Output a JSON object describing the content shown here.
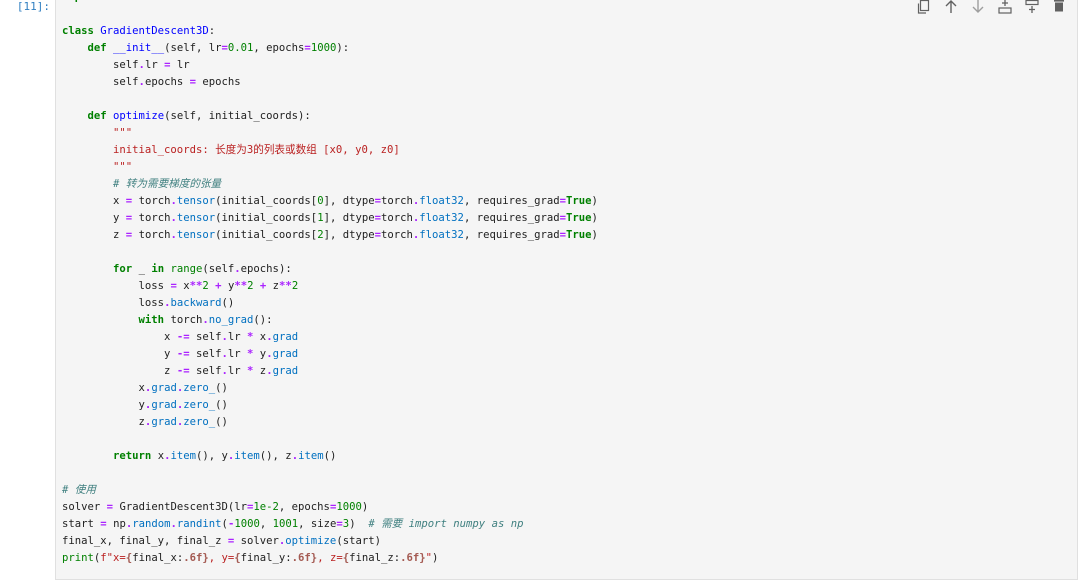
{
  "prompt": "[11]:",
  "toolbar": [
    {
      "name": "duplicate-icon"
    },
    {
      "name": "move-up-icon"
    },
    {
      "name": "move-down-icon"
    },
    {
      "name": "insert-above-icon"
    },
    {
      "name": "insert-below-icon"
    },
    {
      "name": "delete-icon"
    }
  ],
  "code_lines": [
    [
      [
        "kw",
        "import"
      ],
      [
        "",
        "torch"
      ]
    ],
    [],
    [
      [
        "kw",
        "class"
      ],
      [
        "def",
        "GradientDescent3D"
      ],
      [
        "",
        ":"
      ]
    ],
    [
      [
        "",
        "    "
      ],
      [
        "kw",
        "def"
      ],
      [
        "def",
        "__init__"
      ],
      [
        "",
        "(self, lr"
      ],
      [
        "op",
        "="
      ],
      [
        "num",
        "0.01"
      ],
      [
        "",
        ", epochs"
      ],
      [
        "op",
        "="
      ],
      [
        "num",
        "1000"
      ],
      [
        "",
        "):"
      ]
    ],
    [
      [
        "",
        "        self"
      ],
      [
        "op",
        "."
      ],
      [
        "",
        "lr "
      ],
      [
        "op",
        "="
      ],
      [
        "",
        ""
      ],
      [
        "",
        "lr"
      ]
    ],
    [
      [
        "",
        "        self"
      ],
      [
        "op",
        "."
      ],
      [
        "",
        "epochs "
      ],
      [
        "op",
        "="
      ],
      [
        "",
        "epochs"
      ]
    ],
    [],
    [
      [
        "",
        "    "
      ],
      [
        "kw",
        "def"
      ],
      [
        "def",
        "optimize"
      ],
      [
        "",
        "(self, initial_coords):"
      ]
    ],
    [
      [
        "",
        "        "
      ],
      [
        "str",
        "\"\"\""
      ]
    ],
    [
      [
        "",
        "        "
      ],
      [
        "str",
        "initial_coords: 长度为3的列表或数组 [x0, y0, z0]"
      ]
    ],
    [
      [
        "",
        "        "
      ],
      [
        "str",
        "\"\"\""
      ]
    ],
    [
      [
        "",
        "        "
      ],
      [
        "com",
        "# 转为需要梯度的张量"
      ]
    ],
    [
      [
        "",
        "        x "
      ],
      [
        "op",
        "="
      ],
      [
        "",
        "torch"
      ],
      [
        "op",
        "."
      ],
      [
        "attr",
        "tensor"
      ],
      [
        "",
        "(initial_coords["
      ],
      [
        "num",
        "0"
      ],
      [
        "",
        "], dtype"
      ],
      [
        "op",
        "="
      ],
      [
        "",
        "torch"
      ],
      [
        "op",
        "."
      ],
      [
        "attr",
        "float32"
      ],
      [
        "",
        ", requires_grad"
      ],
      [
        "op",
        "="
      ],
      [
        "kw",
        "True"
      ],
      [
        "",
        ")"
      ]
    ],
    [
      [
        "",
        "        y "
      ],
      [
        "op",
        "="
      ],
      [
        "",
        "torch"
      ],
      [
        "op",
        "."
      ],
      [
        "attr",
        "tensor"
      ],
      [
        "",
        "(initial_coords["
      ],
      [
        "num",
        "1"
      ],
      [
        "",
        "], dtype"
      ],
      [
        "op",
        "="
      ],
      [
        "",
        "torch"
      ],
      [
        "op",
        "."
      ],
      [
        "attr",
        "float32"
      ],
      [
        "",
        ", requires_grad"
      ],
      [
        "op",
        "="
      ],
      [
        "kw",
        "True"
      ],
      [
        "",
        ")"
      ]
    ],
    [
      [
        "",
        "        z "
      ],
      [
        "op",
        "="
      ],
      [
        "",
        "torch"
      ],
      [
        "op",
        "."
      ],
      [
        "attr",
        "tensor"
      ],
      [
        "",
        "(initial_coords["
      ],
      [
        "num",
        "2"
      ],
      [
        "",
        "], dtype"
      ],
      [
        "op",
        "="
      ],
      [
        "",
        "torch"
      ],
      [
        "op",
        "."
      ],
      [
        "attr",
        "float32"
      ],
      [
        "",
        ", requires_grad"
      ],
      [
        "op",
        "="
      ],
      [
        "kw",
        "True"
      ],
      [
        "",
        ")"
      ]
    ],
    [],
    [
      [
        "",
        "        "
      ],
      [
        "kw",
        "for"
      ],
      [
        "",
        ""
      ],
      [
        "",
        "_"
      ],
      [
        "",
        ""
      ],
      [
        "kw",
        "in"
      ],
      [
        "bi",
        "range"
      ],
      [
        "",
        "(self"
      ],
      [
        "op",
        "."
      ],
      [
        "",
        "epochs):"
      ]
    ],
    [
      [
        "",
        "            loss "
      ],
      [
        "op",
        "="
      ],
      [
        "",
        "x"
      ],
      [
        "op",
        "**"
      ],
      [
        "num",
        "2"
      ],
      [
        "op",
        "+"
      ],
      [
        "",
        "y"
      ],
      [
        "op",
        "**"
      ],
      [
        "num",
        "2"
      ],
      [
        "op",
        "+"
      ],
      [
        "",
        "z"
      ],
      [
        "op",
        "**"
      ],
      [
        "num",
        "2"
      ]
    ],
    [
      [
        "",
        "            loss"
      ],
      [
        "op",
        "."
      ],
      [
        "attr",
        "backward"
      ],
      [
        "",
        "()"
      ]
    ],
    [
      [
        "",
        "            "
      ],
      [
        "kw",
        "with"
      ],
      [
        "",
        "torch"
      ],
      [
        "op",
        "."
      ],
      [
        "attr",
        "no_grad"
      ],
      [
        "",
        "():"
      ]
    ],
    [
      [
        "",
        "                x "
      ],
      [
        "op",
        "-="
      ],
      [
        "",
        ""
      ],
      [
        "",
        "self"
      ],
      [
        "op",
        "."
      ],
      [
        "",
        "lr "
      ],
      [
        "op",
        "*"
      ],
      [
        "",
        "x"
      ],
      [
        "op",
        "."
      ],
      [
        "attr",
        "grad"
      ]
    ],
    [
      [
        "",
        "                y "
      ],
      [
        "op",
        "-="
      ],
      [
        "",
        ""
      ],
      [
        "",
        "self"
      ],
      [
        "op",
        "."
      ],
      [
        "",
        "lr "
      ],
      [
        "op",
        "*"
      ],
      [
        "",
        "y"
      ],
      [
        "op",
        "."
      ],
      [
        "attr",
        "grad"
      ]
    ],
    [
      [
        "",
        "                z "
      ],
      [
        "op",
        "-="
      ],
      [
        "",
        ""
      ],
      [
        "",
        "self"
      ],
      [
        "op",
        "."
      ],
      [
        "",
        "lr "
      ],
      [
        "op",
        "*"
      ],
      [
        "",
        "z"
      ],
      [
        "op",
        "."
      ],
      [
        "attr",
        "grad"
      ]
    ],
    [
      [
        "",
        "            x"
      ],
      [
        "op",
        "."
      ],
      [
        "attr",
        "grad"
      ],
      [
        "op",
        "."
      ],
      [
        "attr",
        "zero_"
      ],
      [
        "",
        "()"
      ]
    ],
    [
      [
        "",
        "            y"
      ],
      [
        "op",
        "."
      ],
      [
        "attr",
        "grad"
      ],
      [
        "op",
        "."
      ],
      [
        "attr",
        "zero_"
      ],
      [
        "",
        "()"
      ]
    ],
    [
      [
        "",
        "            z"
      ],
      [
        "op",
        "."
      ],
      [
        "attr",
        "grad"
      ],
      [
        "op",
        "."
      ],
      [
        "attr",
        "zero_"
      ],
      [
        "",
        "()"
      ]
    ],
    [],
    [
      [
        "",
        "        "
      ],
      [
        "kw",
        "return"
      ],
      [
        "",
        "x"
      ],
      [
        "op",
        "."
      ],
      [
        "attr",
        "item"
      ],
      [
        "",
        "(), y"
      ],
      [
        "op",
        "."
      ],
      [
        "attr",
        "item"
      ],
      [
        "",
        "(), z"
      ],
      [
        "op",
        "."
      ],
      [
        "attr",
        "item"
      ],
      [
        "",
        "()"
      ]
    ],
    [],
    [
      [
        "com",
        "# 使用"
      ]
    ],
    [
      [
        "",
        "solver "
      ],
      [
        "op",
        "="
      ],
      [
        "",
        "GradientDescent3D(lr"
      ],
      [
        "op",
        "="
      ],
      [
        "num",
        "1e-2"
      ],
      [
        "",
        ", epochs"
      ],
      [
        "op",
        "="
      ],
      [
        "num",
        "1000"
      ],
      [
        "",
        ")"
      ]
    ],
    [
      [
        "",
        "start "
      ],
      [
        "op",
        "="
      ],
      [
        "",
        "np"
      ],
      [
        "op",
        "."
      ],
      [
        "attr",
        "random"
      ],
      [
        "op",
        "."
      ],
      [
        "attr",
        "randint"
      ],
      [
        "",
        "("
      ],
      [
        "op",
        "-"
      ],
      [
        "num",
        "1000"
      ],
      [
        "",
        ", "
      ],
      [
        "num",
        "1001"
      ],
      [
        "",
        ", size"
      ],
      [
        "op",
        "="
      ],
      [
        "num",
        "3"
      ],
      [
        "",
        ")  "
      ],
      [
        "com",
        "# 需要 import numpy as np"
      ]
    ],
    [
      [
        "",
        "final_x, final_y, final_z "
      ],
      [
        "op",
        "="
      ],
      [
        "",
        "solver"
      ],
      [
        "op",
        "."
      ],
      [
        "attr",
        "optimize"
      ],
      [
        "",
        "(start)"
      ]
    ],
    [
      [
        "bi",
        "print"
      ],
      [
        "",
        "("
      ],
      [
        "str",
        "f\"x="
      ],
      [
        "fst",
        "{"
      ],
      [
        "",
        "final_x:"
      ],
      [
        "fst",
        ".6f}"
      ],
      [
        "str",
        ", y="
      ],
      [
        "fst",
        "{"
      ],
      [
        "",
        "final_y:"
      ],
      [
        "fst",
        ".6f}"
      ],
      [
        "str",
        ", z="
      ],
      [
        "fst",
        "{"
      ],
      [
        "",
        "final_z:"
      ],
      [
        "fst",
        ".6f}"
      ],
      [
        "str",
        "\""
      ],
      [
        "",
        ")"
      ]
    ]
  ]
}
